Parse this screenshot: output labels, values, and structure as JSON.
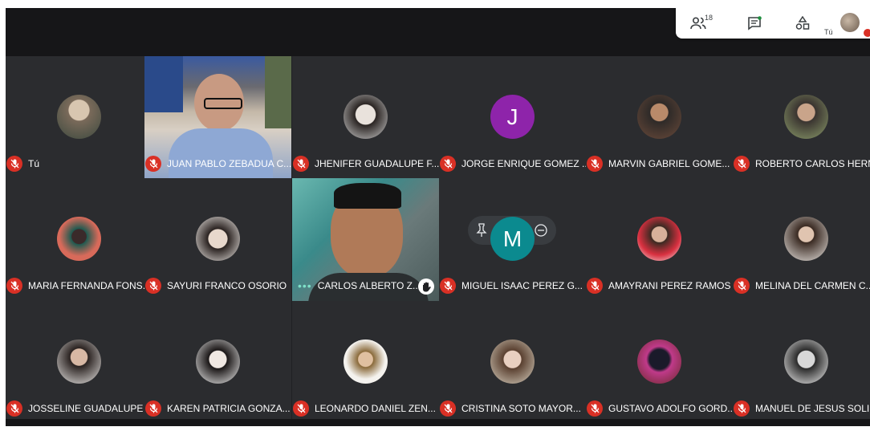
{
  "panel": {
    "participants_count": "18",
    "self_label": "Tú",
    "icons": [
      "people-icon",
      "chat-icon",
      "activities-icon"
    ]
  },
  "tiles": [
    {
      "name": "Tú",
      "type": "avatar"
    },
    {
      "name": "JUAN PABLO ZEBADUA C...",
      "type": "video"
    },
    {
      "name": "JHENIFER GUADALUPE F...",
      "type": "avatar"
    },
    {
      "name": "JORGE ENRIQUE GOMEZ ...",
      "type": "letter",
      "letter": "J",
      "color": "#8e24aa"
    },
    {
      "name": "MARVIN GABRIEL GOME...",
      "type": "avatar"
    },
    {
      "name": "ROBERTO CARLOS HERN...",
      "type": "avatar"
    },
    {
      "name": "MARIA FERNANDA FONS...",
      "type": "avatar"
    },
    {
      "name": "SAYURI FRANCO OSORIO",
      "type": "avatar"
    },
    {
      "name": "CARLOS ALBERTO Z...",
      "type": "video"
    },
    {
      "name": "MIGUEL ISAAC PEREZ G...",
      "type": "letter",
      "letter": "M",
      "color": "#0b8a8f"
    },
    {
      "name": "AMAYRANI PEREZ RAMOS",
      "type": "avatar"
    },
    {
      "name": "MELINA DEL CARMEN C...",
      "type": "avatar"
    },
    {
      "name": "JOSSELINE GUADALUPE ...",
      "type": "avatar"
    },
    {
      "name": "KAREN PATRICIA GONZA...",
      "type": "avatar"
    },
    {
      "name": "LEONARDO DANIEL ZEN...",
      "type": "avatar"
    },
    {
      "name": "CRISTINA SOTO MAYOR...",
      "type": "avatar"
    },
    {
      "name": "GUSTAVO ADOLFO GORD...",
      "type": "avatar"
    },
    {
      "name": "MANUEL DE JESUS SOLI...",
      "type": "avatar"
    }
  ]
}
